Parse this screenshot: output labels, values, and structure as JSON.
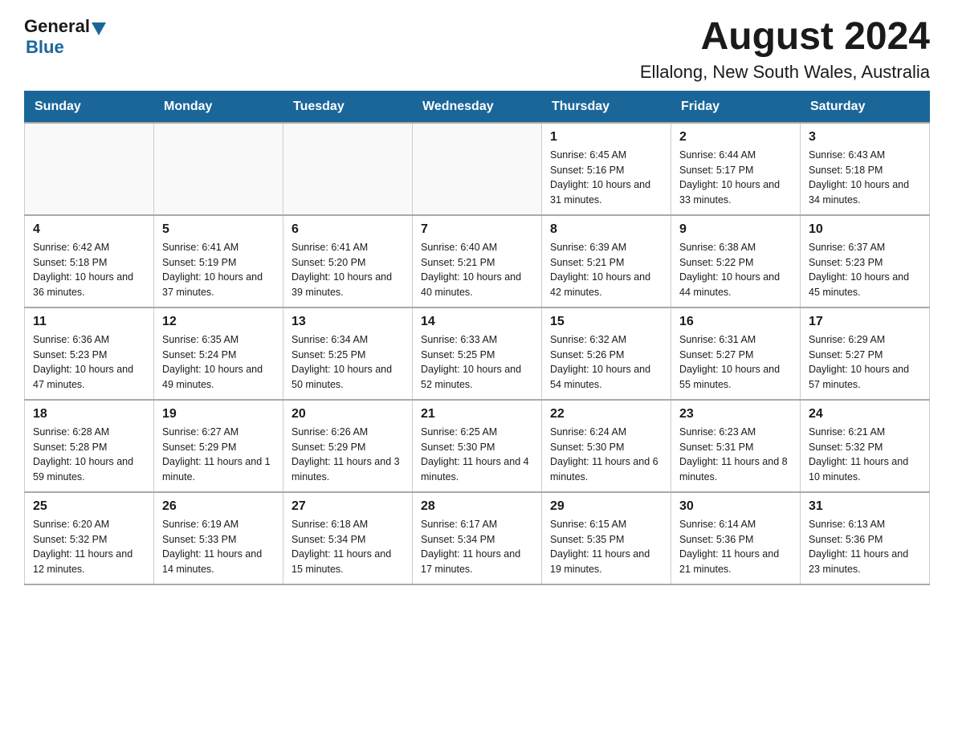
{
  "header": {
    "logo_general": "General",
    "logo_blue": "Blue",
    "month_title": "August 2024",
    "location": "Ellalong, New South Wales, Australia"
  },
  "days_of_week": [
    "Sunday",
    "Monday",
    "Tuesday",
    "Wednesday",
    "Thursday",
    "Friday",
    "Saturday"
  ],
  "weeks": [
    [
      {
        "day": "",
        "info": ""
      },
      {
        "day": "",
        "info": ""
      },
      {
        "day": "",
        "info": ""
      },
      {
        "day": "",
        "info": ""
      },
      {
        "day": "1",
        "info": "Sunrise: 6:45 AM\nSunset: 5:16 PM\nDaylight: 10 hours and 31 minutes."
      },
      {
        "day": "2",
        "info": "Sunrise: 6:44 AM\nSunset: 5:17 PM\nDaylight: 10 hours and 33 minutes."
      },
      {
        "day": "3",
        "info": "Sunrise: 6:43 AM\nSunset: 5:18 PM\nDaylight: 10 hours and 34 minutes."
      }
    ],
    [
      {
        "day": "4",
        "info": "Sunrise: 6:42 AM\nSunset: 5:18 PM\nDaylight: 10 hours and 36 minutes."
      },
      {
        "day": "5",
        "info": "Sunrise: 6:41 AM\nSunset: 5:19 PM\nDaylight: 10 hours and 37 minutes."
      },
      {
        "day": "6",
        "info": "Sunrise: 6:41 AM\nSunset: 5:20 PM\nDaylight: 10 hours and 39 minutes."
      },
      {
        "day": "7",
        "info": "Sunrise: 6:40 AM\nSunset: 5:21 PM\nDaylight: 10 hours and 40 minutes."
      },
      {
        "day": "8",
        "info": "Sunrise: 6:39 AM\nSunset: 5:21 PM\nDaylight: 10 hours and 42 minutes."
      },
      {
        "day": "9",
        "info": "Sunrise: 6:38 AM\nSunset: 5:22 PM\nDaylight: 10 hours and 44 minutes."
      },
      {
        "day": "10",
        "info": "Sunrise: 6:37 AM\nSunset: 5:23 PM\nDaylight: 10 hours and 45 minutes."
      }
    ],
    [
      {
        "day": "11",
        "info": "Sunrise: 6:36 AM\nSunset: 5:23 PM\nDaylight: 10 hours and 47 minutes."
      },
      {
        "day": "12",
        "info": "Sunrise: 6:35 AM\nSunset: 5:24 PM\nDaylight: 10 hours and 49 minutes."
      },
      {
        "day": "13",
        "info": "Sunrise: 6:34 AM\nSunset: 5:25 PM\nDaylight: 10 hours and 50 minutes."
      },
      {
        "day": "14",
        "info": "Sunrise: 6:33 AM\nSunset: 5:25 PM\nDaylight: 10 hours and 52 minutes."
      },
      {
        "day": "15",
        "info": "Sunrise: 6:32 AM\nSunset: 5:26 PM\nDaylight: 10 hours and 54 minutes."
      },
      {
        "day": "16",
        "info": "Sunrise: 6:31 AM\nSunset: 5:27 PM\nDaylight: 10 hours and 55 minutes."
      },
      {
        "day": "17",
        "info": "Sunrise: 6:29 AM\nSunset: 5:27 PM\nDaylight: 10 hours and 57 minutes."
      }
    ],
    [
      {
        "day": "18",
        "info": "Sunrise: 6:28 AM\nSunset: 5:28 PM\nDaylight: 10 hours and 59 minutes."
      },
      {
        "day": "19",
        "info": "Sunrise: 6:27 AM\nSunset: 5:29 PM\nDaylight: 11 hours and 1 minute."
      },
      {
        "day": "20",
        "info": "Sunrise: 6:26 AM\nSunset: 5:29 PM\nDaylight: 11 hours and 3 minutes."
      },
      {
        "day": "21",
        "info": "Sunrise: 6:25 AM\nSunset: 5:30 PM\nDaylight: 11 hours and 4 minutes."
      },
      {
        "day": "22",
        "info": "Sunrise: 6:24 AM\nSunset: 5:30 PM\nDaylight: 11 hours and 6 minutes."
      },
      {
        "day": "23",
        "info": "Sunrise: 6:23 AM\nSunset: 5:31 PM\nDaylight: 11 hours and 8 minutes."
      },
      {
        "day": "24",
        "info": "Sunrise: 6:21 AM\nSunset: 5:32 PM\nDaylight: 11 hours and 10 minutes."
      }
    ],
    [
      {
        "day": "25",
        "info": "Sunrise: 6:20 AM\nSunset: 5:32 PM\nDaylight: 11 hours and 12 minutes."
      },
      {
        "day": "26",
        "info": "Sunrise: 6:19 AM\nSunset: 5:33 PM\nDaylight: 11 hours and 14 minutes."
      },
      {
        "day": "27",
        "info": "Sunrise: 6:18 AM\nSunset: 5:34 PM\nDaylight: 11 hours and 15 minutes."
      },
      {
        "day": "28",
        "info": "Sunrise: 6:17 AM\nSunset: 5:34 PM\nDaylight: 11 hours and 17 minutes."
      },
      {
        "day": "29",
        "info": "Sunrise: 6:15 AM\nSunset: 5:35 PM\nDaylight: 11 hours and 19 minutes."
      },
      {
        "day": "30",
        "info": "Sunrise: 6:14 AM\nSunset: 5:36 PM\nDaylight: 11 hours and 21 minutes."
      },
      {
        "day": "31",
        "info": "Sunrise: 6:13 AM\nSunset: 5:36 PM\nDaylight: 11 hours and 23 minutes."
      }
    ]
  ]
}
